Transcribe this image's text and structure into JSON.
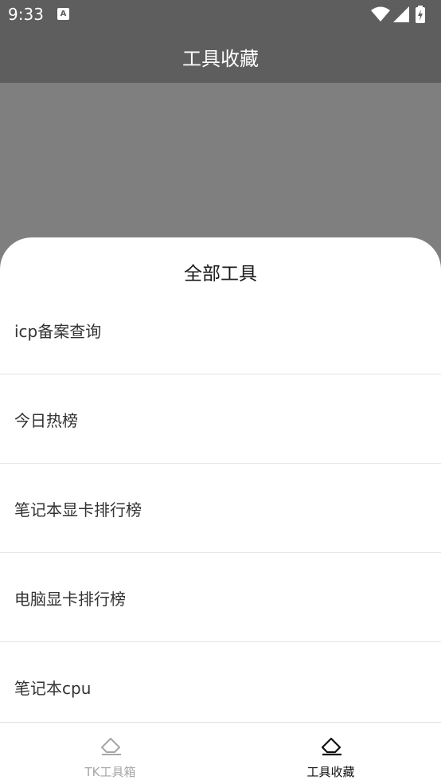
{
  "status_bar": {
    "time": "9:33",
    "notification_icon": "font-icon",
    "right_icons": [
      "wifi-icon",
      "signal-icon",
      "battery-charging-icon"
    ]
  },
  "app_bar": {
    "title": "工具收藏"
  },
  "sheet": {
    "title": "全部工具",
    "items": [
      {
        "label": "icp备案查询"
      },
      {
        "label": "今日热榜"
      },
      {
        "label": "笔记本显卡排行榜"
      },
      {
        "label": "电脑显卡排行榜"
      },
      {
        "label": "笔记本cpu"
      }
    ]
  },
  "bottom_nav": {
    "items": [
      {
        "label": "TK工具箱",
        "icon": "eraser-icon",
        "active": false
      },
      {
        "label": "工具收藏",
        "icon": "eraser-icon",
        "active": true
      }
    ]
  },
  "colors": {
    "app_bar": "#5e5e5e",
    "scrim": "#7f7f7f",
    "sheet": "#ffffff",
    "nav_active": "#111111",
    "nav_inactive": "#a6a6a6"
  }
}
